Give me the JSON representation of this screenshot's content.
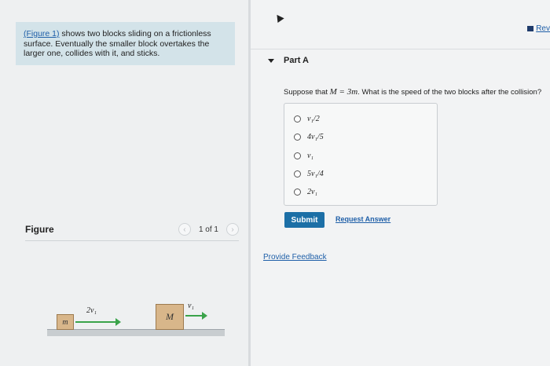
{
  "problem": {
    "link_text": "(Figure 1)",
    "statement": " shows two blocks sliding on a frictionless surface. Eventually the smaller block overtakes the larger one, collides with it, and sticks."
  },
  "figure_panel": {
    "label": "Figure",
    "pager_text": "1 of 1",
    "prev_icon": "chevron-left-icon",
    "next_icon": "chevron-right-icon",
    "small_block_label": "m",
    "large_block_label": "M",
    "small_velocity": "2v₁",
    "large_velocity": "v₁"
  },
  "header": {
    "review_label": "Rev",
    "review_icon": "review-icon"
  },
  "part": {
    "title": "Part A",
    "question_prefix": "Suppose that ",
    "question_math": "M = 3m",
    "question_suffix": ". What is the speed of the two blocks after the collision?"
  },
  "options": [
    {
      "label": "v₁/2"
    },
    {
      "label": "4v₁/5"
    },
    {
      "label": "v₁"
    },
    {
      "label": "5v₁/4"
    },
    {
      "label": "2v₁"
    }
  ],
  "actions": {
    "submit": "Submit",
    "request_answer": "Request Answer",
    "provide_feedback": "Provide Feedback"
  },
  "colors": {
    "accent": "#1c6fa6",
    "link": "#1f5fa8",
    "problem_bg": "#d3e3e9",
    "arrow": "#3aa34a",
    "block": "#d8b68a"
  }
}
